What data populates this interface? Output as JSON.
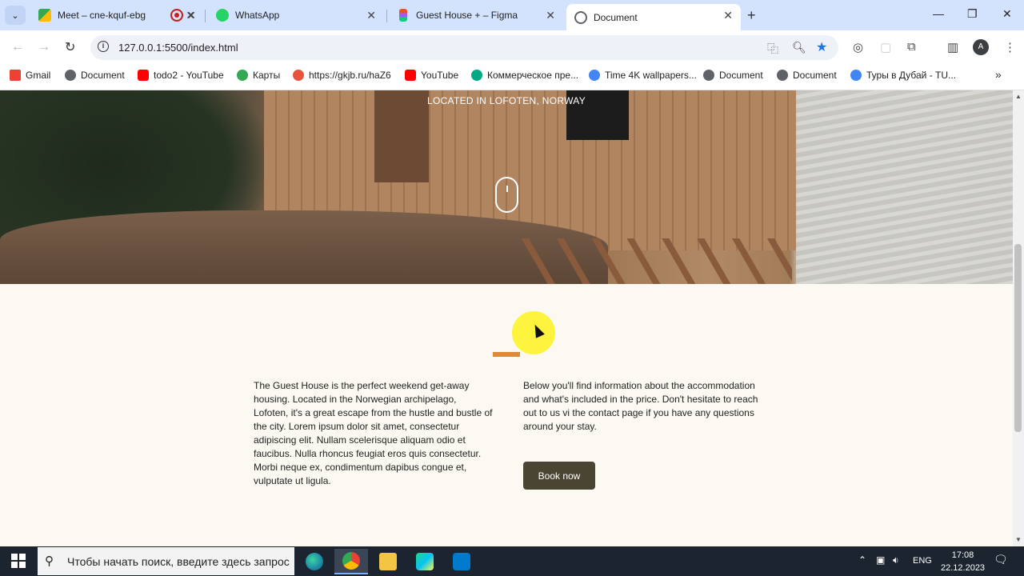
{
  "browser": {
    "tabs": [
      {
        "title": "Meet – cne-kquf-ebg",
        "active": false
      },
      {
        "title": "",
        "active": false
      },
      {
        "title": "WhatsApp",
        "active": false
      },
      {
        "title": "Guest House + – Figma",
        "active": false
      },
      {
        "title": "Document",
        "active": true
      }
    ],
    "new_tab": "+",
    "window_controls": {
      "minimize": "—",
      "restore": "❐",
      "close": "✕"
    },
    "url": "127.0.0.1:5500/index.html",
    "avatar_letter": "A",
    "bookmarks": [
      {
        "label": "Gmail",
        "color": "#ea4335"
      },
      {
        "label": "Document",
        "color": "#5f6368"
      },
      {
        "label": "todo2 - YouTube",
        "color": "#ff0000"
      },
      {
        "label": "Карты",
        "color": "#34a853"
      },
      {
        "label": "https://gkjb.ru/haZ6",
        "color": "#e8543b"
      },
      {
        "label": "YouTube",
        "color": "#ff0000"
      },
      {
        "label": "Коммерческое пре...",
        "color": "#00a884"
      },
      {
        "label": "Time 4K wallpapers...",
        "color": "#4285f4"
      },
      {
        "label": "Document",
        "color": "#5f6368"
      },
      {
        "label": "Document",
        "color": "#5f6368"
      },
      {
        "label": "Туры в Дубай - TU...",
        "color": "#4285f4"
      }
    ]
  },
  "page": {
    "hero_caption": "LOCATED IN LOFOTEN, NORWAY",
    "accent_color": "#d98a3b",
    "left_text": "The Guest House is the perfect weekend get-away housing. Located in the Norwegian archipelago, Lofoten, it's a great escape from the hustle and bustle of the city. Lorem ipsum dolor sit amet, consectetur adipiscing elit. Nullam scelerisque aliquam odio et faucibus. Nulla rhoncus feugiat eros quis consectetur. Morbi neque ex, condimentum dapibus congue et, vulputate ut ligula.",
    "right_text": "Below you'll find information about the accommodation and what's included in the price. Don't hesitate to reach out to us vi the contact page if you have any questions around your stay.",
    "book_button": "Book now",
    "button_color": "#4a4533"
  },
  "taskbar": {
    "search_placeholder": "Чтобы начать поиск, введите здесь запрос",
    "language": "ENG",
    "time": "17:08",
    "date": "22.12.2023"
  }
}
